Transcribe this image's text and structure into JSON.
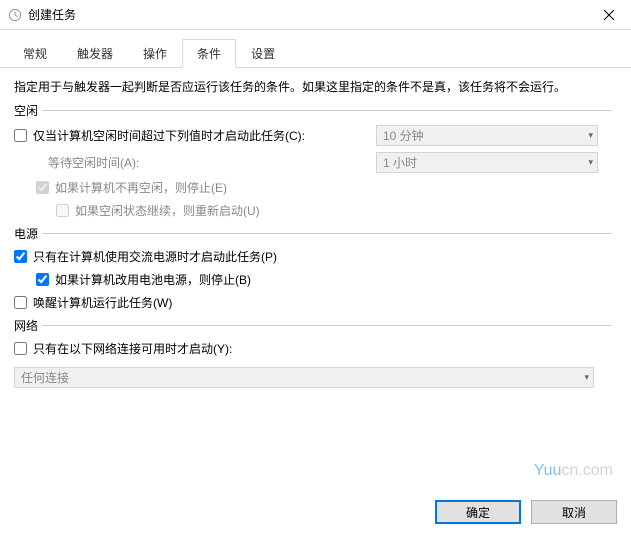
{
  "titlebar": {
    "title": "创建任务"
  },
  "tabs": {
    "items": [
      "常规",
      "触发器",
      "操作",
      "条件",
      "设置"
    ],
    "activeIndex": 3
  },
  "desc": "指定用于与触发器一起判断是否应运行该任务的条件。如果这里指定的条件不是真，该任务将不会运行。",
  "groups": {
    "idle": {
      "title": "空闲",
      "startOnlyIdle": {
        "checked": false,
        "label": "仅当计算机空闲时间超过下列值时才启动此任务(C):"
      },
      "idleDurationCombo": {
        "value": "10 分钟",
        "disabled": true
      },
      "waitLabel": "等待空闲时间(A):",
      "waitCombo": {
        "value": "1 小时",
        "disabled": true
      },
      "stopIfNotIdle": {
        "checked": true,
        "disabled": true,
        "label": "如果计算机不再空闲，则停止(E)"
      },
      "restartIfIdle": {
        "checked": false,
        "disabled": true,
        "label": "如果空闲状态继续，则重新启动(U)"
      }
    },
    "power": {
      "title": "电源",
      "onlyAC": {
        "checked": true,
        "label": "只有在计算机使用交流电源时才启动此任务(P)"
      },
      "stopOnBattery": {
        "checked": true,
        "label": "如果计算机改用电池电源，则停止(B)"
      },
      "wakeToRun": {
        "checked": false,
        "label": "唤醒计算机运行此任务(W)"
      }
    },
    "network": {
      "title": "网络",
      "onlyIfNetwork": {
        "checked": false,
        "label": "只有在以下网络连接可用时才启动(Y):"
      },
      "combo": {
        "value": "任何连接",
        "disabled": true
      }
    }
  },
  "footer": {
    "ok": "确定",
    "cancel": "取消"
  },
  "watermark": {
    "prefix": "Yuu",
    "suffix": "cn.com"
  }
}
